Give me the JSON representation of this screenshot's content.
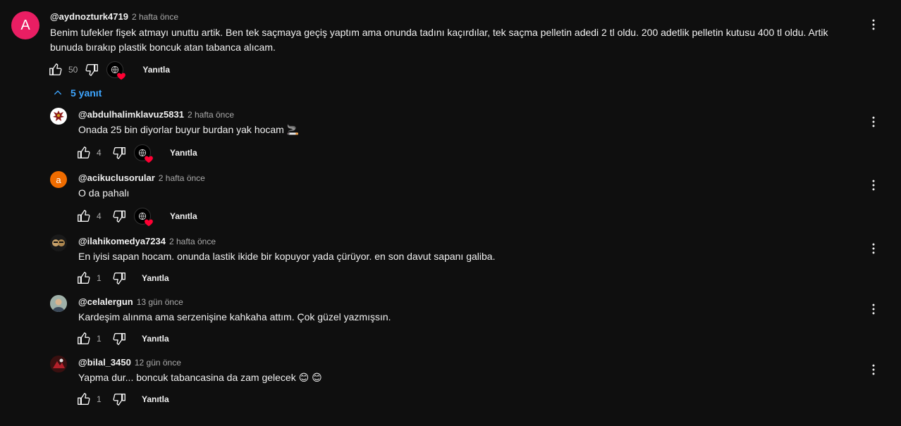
{
  "colors": {
    "background": "#0f0f0f",
    "link": "#3ea6ff",
    "heart": "#ff0033",
    "muted": "#aaaaaa"
  },
  "top_comment": {
    "avatar_letter": "A",
    "avatar_color": "#e91e63",
    "author": "@aydnozturk4719",
    "time": "2 hafta önce",
    "text": "Benim tufekler fişek atmayı unuttu artik. Ben tek saçmaya geçiş yaptım ama onunda tadını kaçırdılar, tek saçma  pelletin adedi  2 tl oldu. 200 adetlik pelletin kutusu 400 tl oldu. Artik bunuda bırakıp plastik boncuk atan tabanca alıcam.",
    "likes": "50",
    "reply_label": "Yanıtla",
    "hearted": true
  },
  "replies_toggle": {
    "icon": "chevron-up-icon",
    "label": "5 yanıt"
  },
  "replies": [
    {
      "author": "@abdulhalimklavuz5831",
      "time": "2 hafta önce",
      "text": "Onada 25 bin diyorlar buyur burdan yak hocam 🚬",
      "likes": "4",
      "reply_label": "Yanıtla",
      "hearted": true,
      "avatar": "eagle"
    },
    {
      "author": "@acikuclusorular",
      "time": "2 hafta önce",
      "text": "O da pahalı",
      "likes": "4",
      "reply_label": "Yanıtla",
      "hearted": true,
      "avatar_letter": "a",
      "avatar_color": "#ef6c00"
    },
    {
      "author": "@ilahikomedya7234",
      "time": "2 hafta önce",
      "text": "En iyisi sapan hocam. onunda lastik ikide bir kopuyor yada çürüyor.  en son davut sapanı  galiba.",
      "likes": "1",
      "reply_label": "Yanıtla",
      "hearted": false,
      "avatar": "faces"
    },
    {
      "author": "@celalergun",
      "time": "13 gün önce",
      "text": "Kardeşim alınma ama serzenişine kahkaha attım. Çok güzel yazmışsın.",
      "likes": "1",
      "reply_label": "Yanıtla",
      "hearted": false,
      "avatar": "photo"
    },
    {
      "author": "@bilal_3450",
      "time": "12 gün önce",
      "text": "Yapma dur... boncuk tabancasina da zam gelecek 😊 😊",
      "likes": "1",
      "reply_label": "Yanıtla",
      "hearted": false,
      "avatar": "red"
    }
  ]
}
